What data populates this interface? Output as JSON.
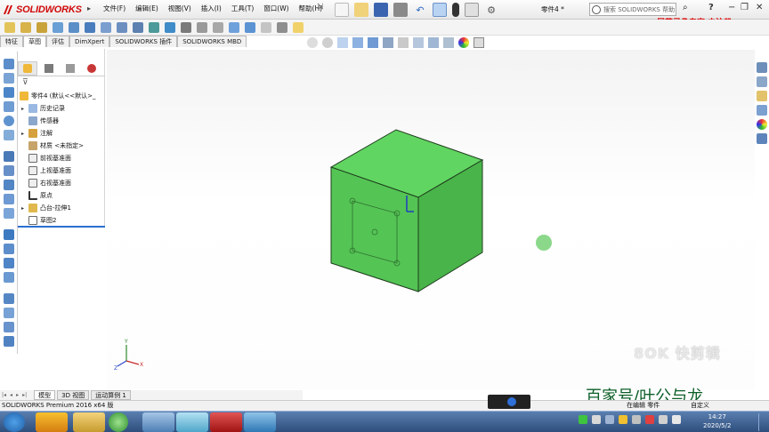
{
  "app": {
    "logo_text": "SOLIDWORKS",
    "menus": [
      "文件(F)",
      "编辑(E)",
      "视图(V)",
      "插入(I)",
      "工具(T)",
      "窗口(W)",
      "帮助(H)"
    ],
    "document_title": "零件4 *",
    "search_placeholder": "搜索 SOLIDWORKS 帮助",
    "help_label": "?"
  },
  "watermark_top": "屏幕录像专家 未注册",
  "command_tabs": [
    "特征",
    "草图",
    "评估",
    "DimXpert",
    "SOLIDWORKS 插件",
    "SOLIDWORKS MBD"
  ],
  "feature_tree": {
    "root": "零件4 (默认<<默认>_",
    "items": [
      {
        "label": "历史记录",
        "expandable": true
      },
      {
        "label": "传感器",
        "expandable": false
      },
      {
        "label": "注解",
        "expandable": true
      },
      {
        "label": "材质 <未指定>",
        "expandable": false
      },
      {
        "label": "前视基准面",
        "expandable": false
      },
      {
        "label": "上视基准面",
        "expandable": false
      },
      {
        "label": "右视基准面",
        "expandable": false
      },
      {
        "label": "原点",
        "expandable": false
      },
      {
        "label": "凸台-拉伸1",
        "expandable": true
      },
      {
        "label": "草图2",
        "expandable": false
      }
    ]
  },
  "bottom_tabs": [
    "模型",
    "3D 视图",
    "运动算例 1"
  ],
  "status": {
    "product": "SOLIDWORKS Premium 2016 x64 版",
    "editing": "在编辑 零件",
    "custom": "自定义"
  },
  "overlay": {
    "kuaijian": "8OK 快剪辑",
    "baijiahao": "百家号/叶公与龙"
  },
  "taskbar": {
    "time": "14:27",
    "date": "2020/5/2"
  },
  "colors": {
    "cube_front": "#54c454",
    "cube_top": "#61d561",
    "cube_side": "#49b449",
    "brand_red": "#d10a0a"
  }
}
